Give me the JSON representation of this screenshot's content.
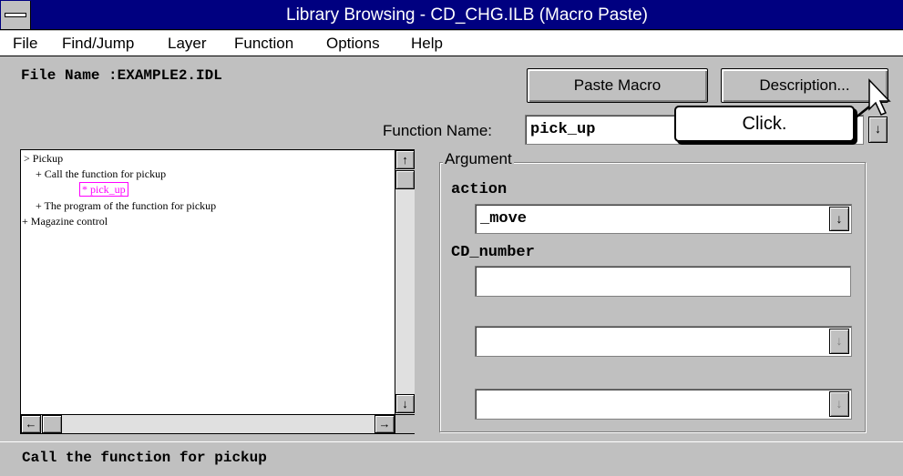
{
  "window": {
    "title": "Library Browsing - CD_CHG.ILB (Macro Paste)"
  },
  "menu": [
    {
      "label": "File"
    },
    {
      "label": "Find/Jump"
    },
    {
      "label": "Layer"
    },
    {
      "label": "Function"
    },
    {
      "label": "Options"
    },
    {
      "label": "Help"
    }
  ],
  "file_name": "File Name :EXAMPLE2.IDL",
  "buttons": {
    "paste_macro": "Paste Macro",
    "description": "Description..."
  },
  "function_name": {
    "label": "Function Name:",
    "value": "pick_up"
  },
  "callout": "Click.",
  "tree": [
    "> Pickup",
    "+ Call the function for pickup",
    "* pick_up",
    "+ The program of the function for pickup",
    "+ Magazine control"
  ],
  "argument": {
    "title": "Argument",
    "action_label": "action",
    "action_value": "_move",
    "cd_number_label": "CD_number",
    "cd_number_value": ""
  },
  "icons": {
    "dropdown": "down-arrow",
    "scroll_up": "up-arrow",
    "scroll_down": "down-arrow",
    "scroll_left": "left-arrow",
    "scroll_right": "right-arrow"
  },
  "colors": {
    "titlebar": "#000080",
    "tree_selected": "#ff00ff"
  },
  "status": "Call the function for pickup"
}
